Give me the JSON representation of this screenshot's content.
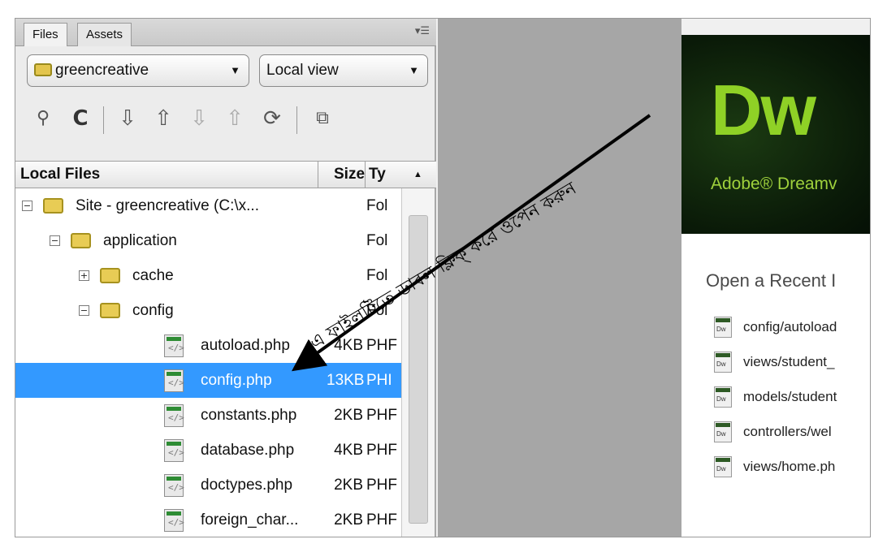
{
  "panel": {
    "tabs": [
      "Files",
      "Assets"
    ],
    "site_select": "greencreative",
    "view_select": "Local view",
    "columns": {
      "name": "Local Files",
      "size": "Size",
      "type": "Ty"
    }
  },
  "tree": [
    {
      "name": "Site - greencreative (C:\\x...",
      "size": "",
      "type": "Fol",
      "kind": "folder",
      "expander": "−",
      "level": 0
    },
    {
      "name": "application",
      "size": "",
      "type": "Fol",
      "kind": "folder",
      "expander": "−",
      "level": 1
    },
    {
      "name": "cache",
      "size": "",
      "type": "Fol",
      "kind": "folder",
      "expander": "+",
      "level": 2
    },
    {
      "name": "config",
      "size": "",
      "type": "Fol",
      "kind": "folder",
      "expander": "−",
      "level": 2
    },
    {
      "name": "autoload.php",
      "size": "4KB",
      "type": "PHF",
      "kind": "php",
      "level": 3
    },
    {
      "name": "config.php",
      "size": "13KB",
      "type": "PHI",
      "kind": "php",
      "level": 3,
      "selected": true
    },
    {
      "name": "constants.php",
      "size": "2KB",
      "type": "PHF",
      "kind": "php",
      "level": 3
    },
    {
      "name": "database.php",
      "size": "4KB",
      "type": "PHF",
      "kind": "php",
      "level": 3
    },
    {
      "name": "doctypes.php",
      "size": "2KB",
      "type": "PHF",
      "kind": "php",
      "level": 3
    },
    {
      "name": "foreign_char...",
      "size": "2KB",
      "type": "PHF",
      "kind": "php",
      "level": 3
    }
  ],
  "welcome": {
    "logo": "Dw",
    "subtitle": "Adobe® Dreamv",
    "recent_title": "Open a Recent I",
    "file_badge": "Dw",
    "recent_items": [
      "config/autoload",
      "views/student_",
      "models/student",
      "controllers/wel",
      "views/home.ph"
    ]
  },
  "annotation": {
    "text": "এ ফাইলটিতে ডাবল ক্লিক্‌ করে ওপেন করুন"
  },
  "colors": {
    "selection": "#3399ff",
    "dw_green": "#8fd126",
    "banner_bg": "#0a1a08"
  }
}
